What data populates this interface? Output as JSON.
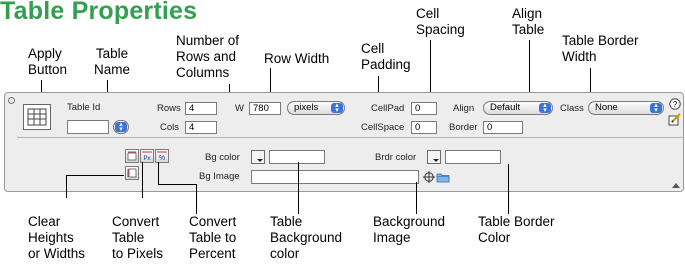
{
  "title": "Table Properties",
  "callouts": {
    "apply_button": "Apply\nButton",
    "table_name": "Table\nName",
    "rows_columns": "Number of\nRows and\nColumns",
    "row_width": "Row Width",
    "cell_padding": "Cell\nPadding",
    "cell_spacing": "Cell\nSpacing",
    "align_table": "Align\nTable",
    "table_border_width": "Table Border\nWidth",
    "clear_heights": "Clear\nHeights\nor Widths",
    "convert_pixels": "Convert\nTable\nto Pixels",
    "convert_percent": "Convert\nTable to\nPercent",
    "table_bg_color": "Table\nBackground\ncolor",
    "bg_image": "Background\nImage",
    "table_border_color": "Table Border\nColor"
  },
  "inspector": {
    "table_id_label": "Table Id",
    "table_id_value": "",
    "rows_label": "Rows",
    "rows_value": "4",
    "cols_label": "Cols",
    "cols_value": "4",
    "w_label": "W",
    "w_value": "780",
    "w_unit": "pixels",
    "cellpad_label": "CellPad",
    "cellpad_value": "0",
    "cellspace_label": "CellSpace",
    "cellspace_value": "0",
    "align_label": "Align",
    "align_value": "Default",
    "border_label": "Border",
    "border_value": "0",
    "class_label": "Class",
    "class_value": "None",
    "bg_color_label": "Bg color",
    "bg_color_value": "",
    "brdr_color_label": "Brdr color",
    "brdr_color_value": "",
    "bg_image_label": "Bg Image",
    "bg_image_value": ""
  },
  "icons": {
    "table": "table-icon",
    "help": "help-icon",
    "edit": "edit-icon",
    "clear": "clear-heights-widths-icon",
    "to_pixels": "convert-to-pixels-icon",
    "to_percent": "convert-to-percent-icon",
    "point_to_file": "point-to-file-icon",
    "browse_folder": "folder-icon",
    "expander": "expander-arrow-icon"
  },
  "colors": {
    "title": "#33a050",
    "panel_bg": "#ededed",
    "select_arrow": "#3a74d4"
  }
}
